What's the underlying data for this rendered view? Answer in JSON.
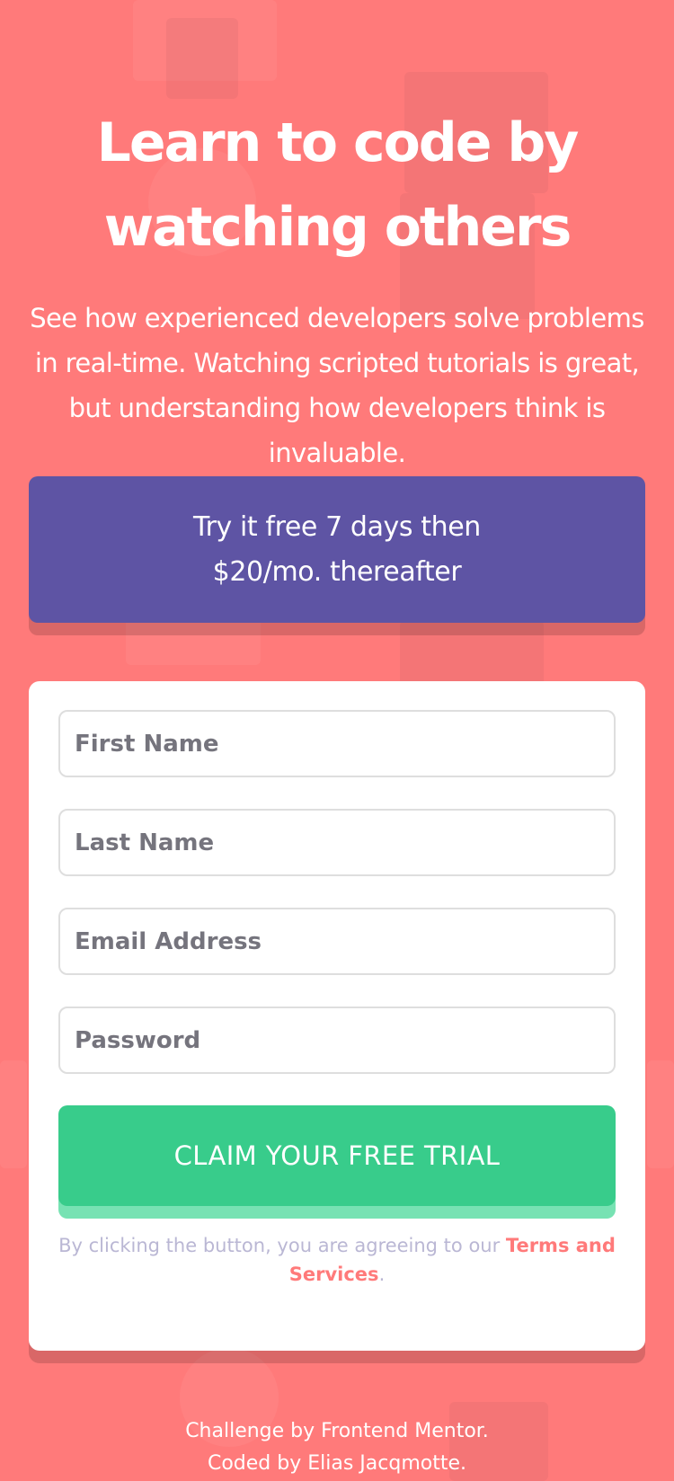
{
  "hero": {
    "title_line1": "Learn to code by",
    "title_line2": "watching others",
    "description": "See how experienced developers solve problems in real-time. Watching scripted tutorials is great, but understanding how developers think is invaluable."
  },
  "offer": {
    "text_line1": "Try it free 7 days then",
    "text_line2": "$20/mo. thereafter"
  },
  "form": {
    "first_name_placeholder": "First Name",
    "last_name_placeholder": "Last Name",
    "email_placeholder": "Email Address",
    "password_placeholder": "Password",
    "submit_label": "CLAIM YOUR FREE TRIAL",
    "terms_prefix": "By clicking the button, you are agreeing to our ",
    "terms_link": "Terms and Services",
    "terms_suffix": "."
  },
  "footer": {
    "line1": "Challenge by Frontend Mentor.",
    "line2": "Coded by Elias Jacqmotte."
  },
  "colors": {
    "background": "#ff7a7a",
    "offer_box": "#5e54a4",
    "submit_button": "#38cc8b",
    "terms_link": "#ff7a7a"
  }
}
